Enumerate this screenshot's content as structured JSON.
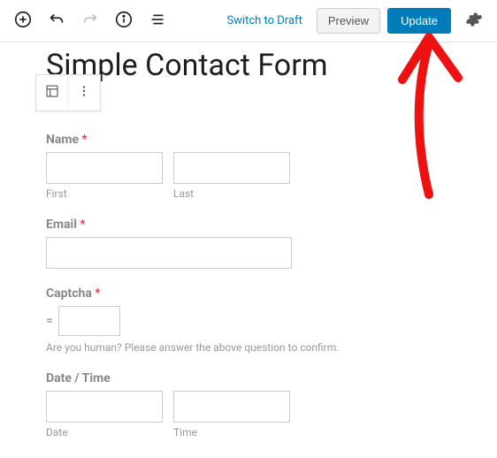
{
  "topbar": {
    "switch_draft": "Switch to Draft",
    "preview": "Preview",
    "update": "Update"
  },
  "page": {
    "title": "Simple Contact Form"
  },
  "form": {
    "name": {
      "label": "Name",
      "required_mark": "*",
      "first_sub": "First",
      "last_sub": "Last"
    },
    "email": {
      "label": "Email",
      "required_mark": "*"
    },
    "captcha": {
      "label": "Captcha",
      "required_mark": "*",
      "equals": "=",
      "help": "Are you human? Please answer the above question to confirm."
    },
    "datetime": {
      "label": "Date / Time",
      "date_sub": "Date",
      "time_sub": "Time"
    }
  }
}
